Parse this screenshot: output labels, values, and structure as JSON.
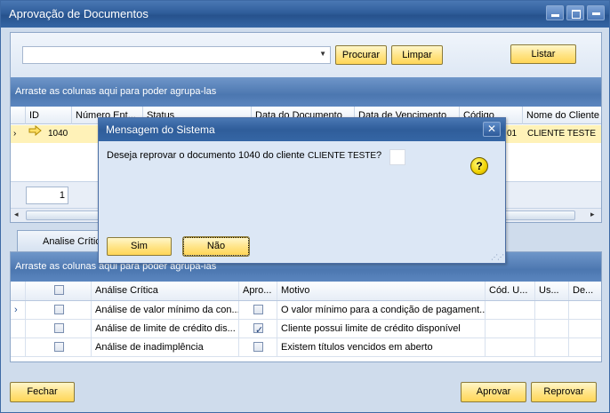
{
  "window": {
    "title": "Aprovação de Documentos"
  },
  "search": {
    "combo_value": "",
    "procurar_label": "Procurar",
    "limpar_label": "Limpar",
    "listar_label": "Listar"
  },
  "top_grid": {
    "group_hint": "Arraste as colunas aqui para poder agrupa-las",
    "columns": [
      "ID",
      "Número Ent...",
      "Status",
      "Data do Documento",
      "Data de Vencimento",
      "Código",
      "Nome do Cliente"
    ],
    "row": {
      "id": "1040",
      "codigo_suffix": "01",
      "cliente": "CLIENTE TESTE"
    },
    "page": "1"
  },
  "tab": {
    "label": "Analise Crític"
  },
  "bottom_grid": {
    "group_hint": "Arraste as colunas aqui para poder agrupa-las",
    "columns": [
      "",
      "Análise Crítica",
      "Apro...",
      "Motivo",
      "Cód. U...",
      "Us...",
      "De..."
    ],
    "rows": [
      {
        "analise": "Análise de valor mínimo da con...",
        "aprovado": false,
        "motivo": "O valor mínimo para a condição de pagament..."
      },
      {
        "analise": "Análise de limite de crédito dis...",
        "aprovado": true,
        "motivo": "Cliente possui limite de crédito disponível"
      },
      {
        "analise": "Análise de inadimplência",
        "aprovado": false,
        "motivo": "Existem títulos vencidos em aberto"
      }
    ]
  },
  "footer": {
    "fechar_label": "Fechar",
    "aprovar_label": "Aprovar",
    "reprovar_label": "Reprovar"
  },
  "dialog": {
    "title": "Mensagem do Sistema",
    "message": "Deseja reprovar o documento 1040 do cliente",
    "client": "CLIENTE TESTE",
    "question_mark": "?",
    "sim_label": "Sim",
    "nao_label": "Não"
  },
  "colors": {
    "title_bar": "#2f5d9a",
    "button_yellow": "#ffd657",
    "selected_row": "#fff2b8"
  }
}
